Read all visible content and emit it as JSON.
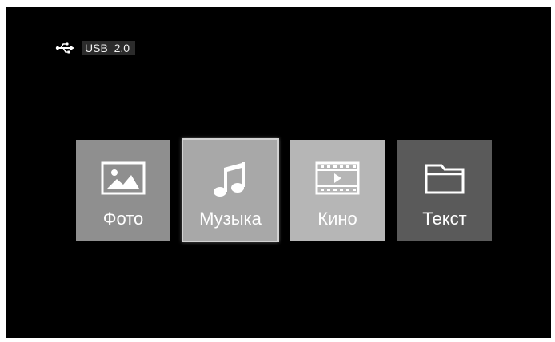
{
  "status": {
    "source_icon": "usb-icon",
    "source_label": "USB  2.0"
  },
  "menu": {
    "items": [
      {
        "label": "Фото",
        "icon": "image-icon",
        "color": "#8f8f8f"
      },
      {
        "label": "Музыка",
        "icon": "music-note-icon",
        "color": "#a8a8a8",
        "selected": true
      },
      {
        "label": "Кино",
        "icon": "film-icon",
        "color": "#b6b6b6"
      },
      {
        "label": "Текст",
        "icon": "folder-icon",
        "color": "#5a5a5a"
      }
    ]
  }
}
